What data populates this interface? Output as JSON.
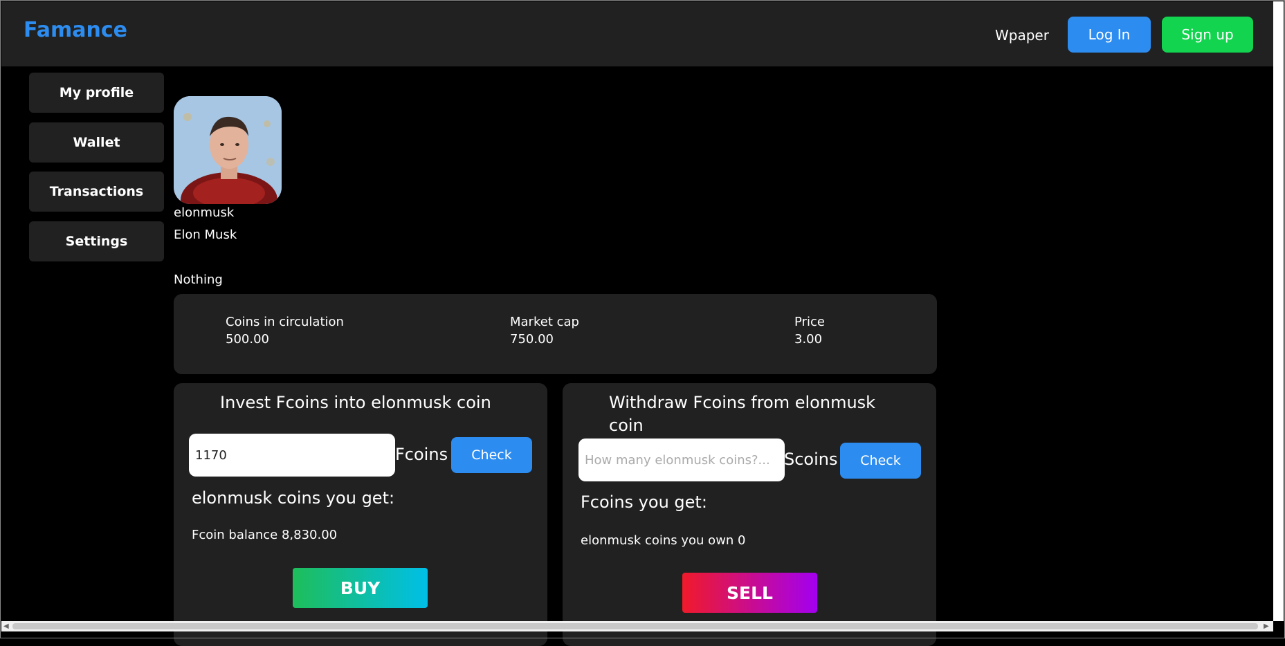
{
  "header": {
    "brand": "Famance",
    "nav_link": "Wpaper",
    "login_label": "Log In",
    "signup_label": "Sign up"
  },
  "sidebar": {
    "items": [
      {
        "label": "My profile"
      },
      {
        "label": "Wallet"
      },
      {
        "label": "Transactions"
      },
      {
        "label": "Settings"
      }
    ]
  },
  "profile": {
    "username": "elonmusk",
    "full_name": "Elon Musk",
    "bio": "Nothing"
  },
  "stats": {
    "circulation_label": "Coins in circulation",
    "circulation_value": "500.00",
    "market_cap_label": "Market cap",
    "market_cap_value": "750.00",
    "price_label": "Price",
    "price_value": "3.00"
  },
  "invest": {
    "title": "Invest Fcoins into elonmusk coin",
    "input_value": "1170",
    "unit": "Fcoins",
    "check_label": "Check",
    "result_label": "elonmusk coins you get:",
    "balance_text": "Fcoin balance 8,830.00",
    "buy_label": "BUY"
  },
  "withdraw": {
    "title_line1": "Withdraw Fcoins from  elonmusk",
    "title_line2": "coin",
    "input_placeholder": "How many elonmusk coins?...",
    "unit": "Scoins",
    "check_label": "Check",
    "result_label": "Fcoins you get:",
    "owned_text": "elonmusk coins you own 0",
    "sell_label": "SELL"
  },
  "colors": {
    "brand": "#2d8cf0",
    "login": "#2d8cf0",
    "signup": "#13d44f",
    "panel": "#212121"
  }
}
